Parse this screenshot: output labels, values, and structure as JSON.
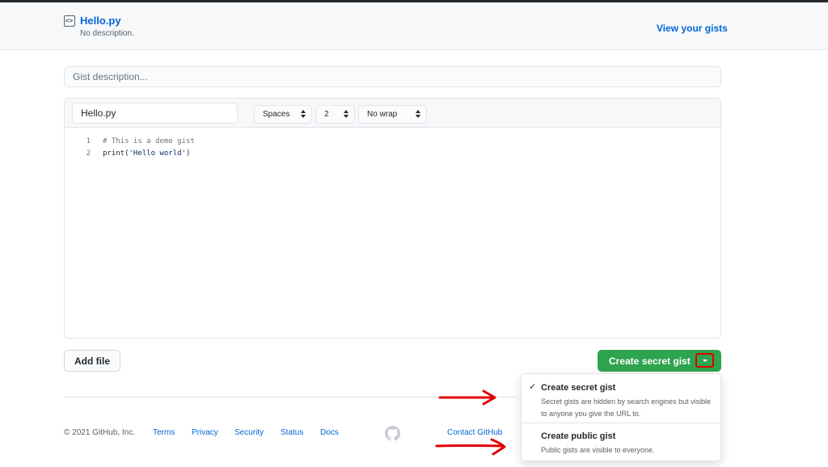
{
  "header": {
    "icon": "code-file-icon",
    "title": "Hello.py",
    "description": "No description.",
    "view_gists_link": "View your gists"
  },
  "form": {
    "description_placeholder": "Gist description...",
    "file": {
      "filename": "Hello.py",
      "indent_mode": "Spaces",
      "indent_size": "2",
      "wrap_mode": "No wrap",
      "code_lines": [
        {
          "number": "1",
          "text": "# This is a demo gist"
        },
        {
          "number": "2",
          "prefix": "print(",
          "string": "'Hello world'",
          "suffix": ")"
        }
      ]
    },
    "add_file_label": "Add file",
    "create_button_label": "Create secret gist"
  },
  "create_menu": {
    "items": [
      {
        "title": "Create secret gist",
        "description": "Secret gists are hidden by search engines but visible to anyone you give the URL to.",
        "selected": true
      },
      {
        "title": "Create public gist",
        "description": "Public gists are visible to everyone.",
        "selected": false
      }
    ]
  },
  "footer": {
    "copyright": "© 2021 GitHub, Inc.",
    "links": [
      "Terms",
      "Privacy",
      "Security",
      "Status",
      "Docs"
    ],
    "contact_link": "Contact GitHub",
    "logo_icon": "github-octocat-icon"
  },
  "colors": {
    "primary_button": "#2ea44f",
    "link": "#0366d6",
    "annotation": "#e00000"
  }
}
